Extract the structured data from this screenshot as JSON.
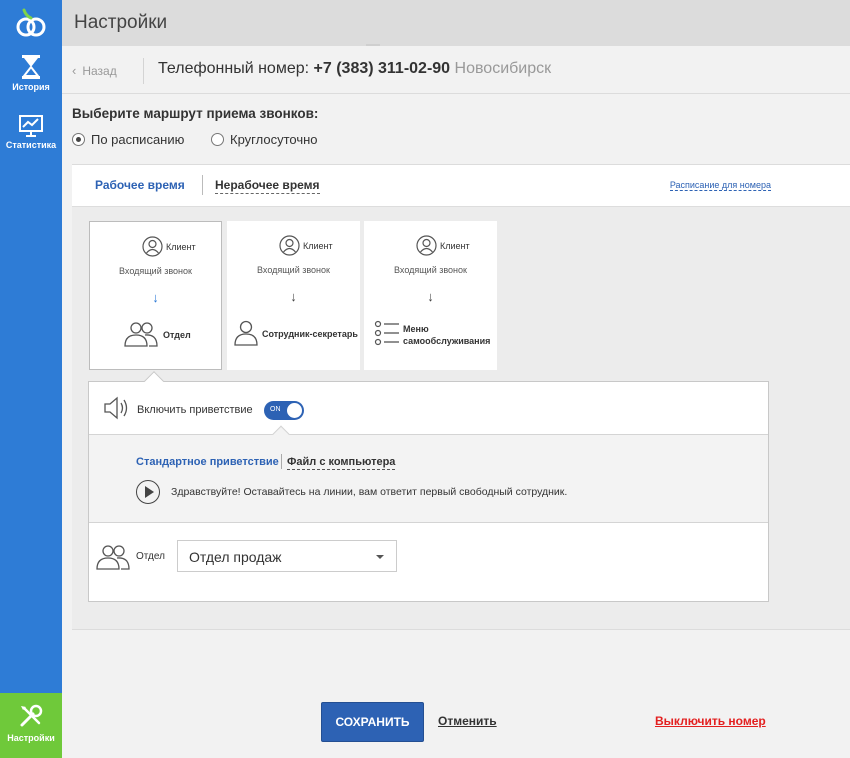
{
  "sidebar": {
    "logo_icon": "logo-icon",
    "items": [
      {
        "label": "История",
        "icon": "hourglass-icon"
      },
      {
        "label": "Статистика",
        "icon": "chart-icon"
      },
      {
        "label": "Настройки",
        "icon": "tools-icon"
      }
    ]
  },
  "header": {
    "title": "Настройки"
  },
  "subheader": {
    "back_label": "Назад",
    "phone_prefix": "Телефонный номер:",
    "phone_number": "+7 (383) 311-02-90",
    "city": "Новосибирск"
  },
  "route": {
    "title": "Выберите маршрут приема звонков:",
    "options": [
      {
        "label": "По расписанию",
        "selected": true
      },
      {
        "label": "Круглосуточно",
        "selected": false
      }
    ]
  },
  "tabs": {
    "work": "Рабочее время",
    "nonwork": "Нерабочее время",
    "schedule_link": "Расписание для номера"
  },
  "cards": [
    {
      "client": "Клиент",
      "incoming": "Входящий звонок",
      "arrow": "↓",
      "target": "Отдел"
    },
    {
      "client": "Клиент",
      "incoming": "Входящий звонок",
      "arrow": "↓",
      "target": "Сотрудник-секретарь"
    },
    {
      "client": "Клиент",
      "incoming": "Входящий звонок",
      "arrow": "↓",
      "target_line1": "Меню",
      "target_line2": "самообслуживания"
    }
  ],
  "greeting": {
    "label": "Включить приветствие",
    "toggle_text": "ON",
    "tab_standard": "Стандартное приветствие",
    "tab_file": "Файл с компьютера",
    "text": "Здравствуйте! Оставайтесь на линии, вам ответит первый свободный сотрудник."
  },
  "department": {
    "label": "Отдел",
    "selected": "Отдел продаж"
  },
  "footer": {
    "save": "СОХРАНИТЬ",
    "cancel": "Отменить",
    "disable": "Выключить номер"
  },
  "colors": {
    "sidebar": "#2e7cd6",
    "active_nav": "#6fc93a",
    "accent": "#2d62b4",
    "danger": "#e32020"
  }
}
